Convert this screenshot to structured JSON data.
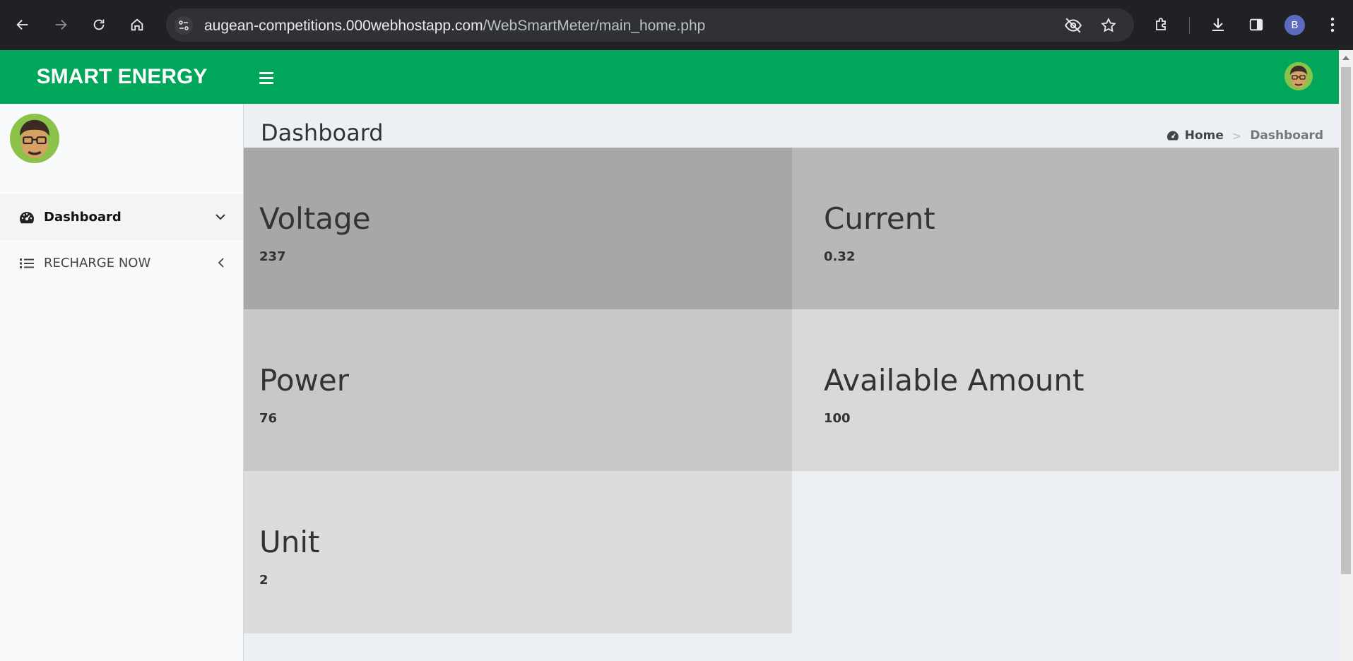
{
  "browser": {
    "url_domain": "augean-competitions.000webhostapp.com",
    "url_path": "/WebSmartMeter/main_home.php",
    "profile_initial": "B"
  },
  "header": {
    "brand": "SMART ENERGY",
    "color": "#00a65a"
  },
  "sidebar": {
    "items": [
      {
        "label": "Dashboard",
        "icon": "dashboard-gauge-icon",
        "arrow": "chevron-down-icon"
      },
      {
        "label": "RECHARGE NOW",
        "icon": "list-icon",
        "arrow": "chevron-left-icon"
      }
    ]
  },
  "content": {
    "title": "Dashboard",
    "breadcrumb": {
      "home": "Home",
      "separator": ">",
      "current": "Dashboard"
    },
    "tiles": [
      {
        "label": "Voltage",
        "value": "237",
        "color": "#a7a7a7"
      },
      {
        "label": "Current",
        "value": "0.32",
        "color": "#b8b8b8"
      },
      {
        "label": "Power",
        "value": "76",
        "color": "#c8c8c8"
      },
      {
        "label": "Available Amount",
        "value": "100",
        "color": "#d9d9d9"
      },
      {
        "label": "Unit",
        "value": "2",
        "color": "#dcdcdc"
      }
    ]
  }
}
